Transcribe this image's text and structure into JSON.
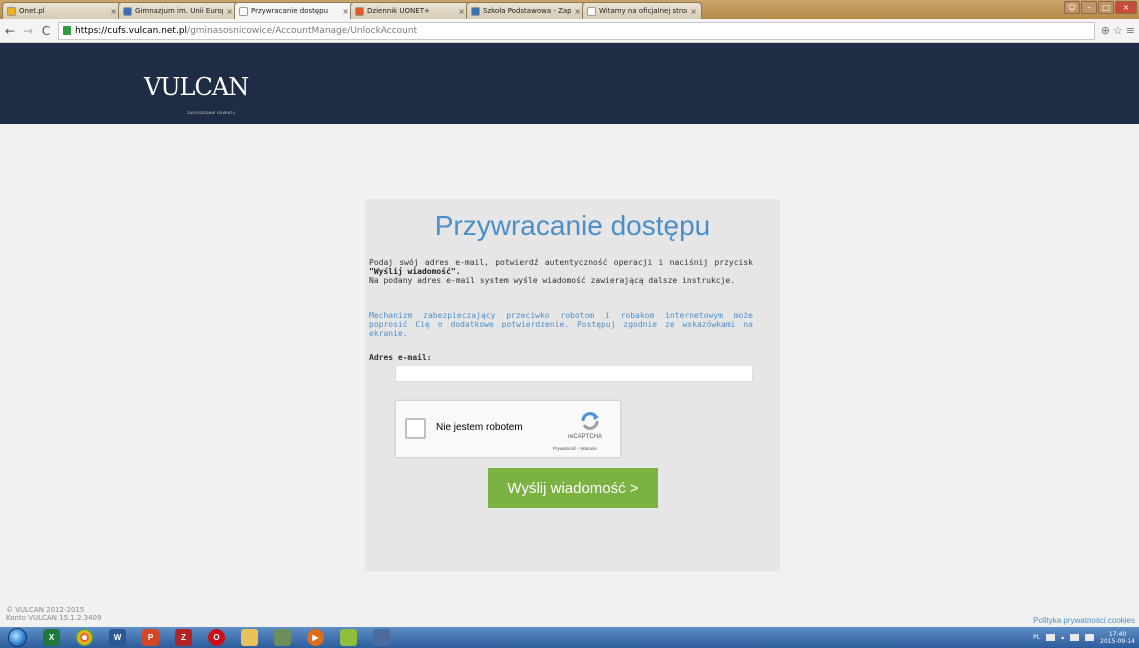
{
  "browser": {
    "tabs": [
      {
        "title": "Onet.pl",
        "fav_color": "#f2b021",
        "active": false
      },
      {
        "title": "Gimnazjum im. Unii Europ",
        "fav_color": "#3a6fb0",
        "active": false
      },
      {
        "title": "Przywracanie dostępu",
        "fav_color": "#ffffff",
        "active": true
      },
      {
        "title": "Dziennik UONET+",
        "fav_color": "#e05a2b",
        "active": false
      },
      {
        "title": "Szkoła Podstawowa - Zap",
        "fav_color": "#3a6fb0",
        "active": false
      },
      {
        "title": "Witamy na oficjalnej stron",
        "fav_color": "#ffffff",
        "active": false
      }
    ],
    "tab_close_glyph": "×",
    "url_host": "https://cufs.vulcan.net.pl",
    "url_path": "/gminasosnicowice/AccountManage/UnlockAccount"
  },
  "header": {
    "logo_text": "VULCAN",
    "logo_sub": "ZARZĄDZANIE OŚWIATĄ"
  },
  "card": {
    "title": "Przywracanie dostępu",
    "para1_pre": "Podaj swój adres e-mail, potwierdź autentyczność operacji i naciśnij przycisk ",
    "para1_bold": "\"Wyślij wiadomość\".",
    "para1_post": "Na podany adres e-mail system wyśle wiadomość zawierającą dalsze instrukcje.",
    "para2": "Mechanizm zabezpieczający przeciwko robotom i robakom internetowym może poprosić Cię o dodatkowe potwierdzenie. Postępuj zgodnie ze wskazówkami na ekranie.",
    "email_label": "Adres e-mail:",
    "email_value": "",
    "captcha_label": "Nie jestem robotem",
    "captcha_brand": "reCAPTCHA",
    "captcha_terms": "Prywatność - Warunki",
    "send_button": "Wyślij wiadomość >"
  },
  "footer": {
    "copyright": "© VULCAN 2012-2015",
    "version": "Konto VULCAN 15.1.2.3409",
    "privacy_link": "Polityka prywatności cookies"
  },
  "taskbar": {
    "language": "PL",
    "time": "17:40",
    "date": "2015-09-14"
  },
  "colors": {
    "header_bg": "#1e2d45",
    "accent_blue": "#4b8fca",
    "button_green": "#7bb241"
  }
}
